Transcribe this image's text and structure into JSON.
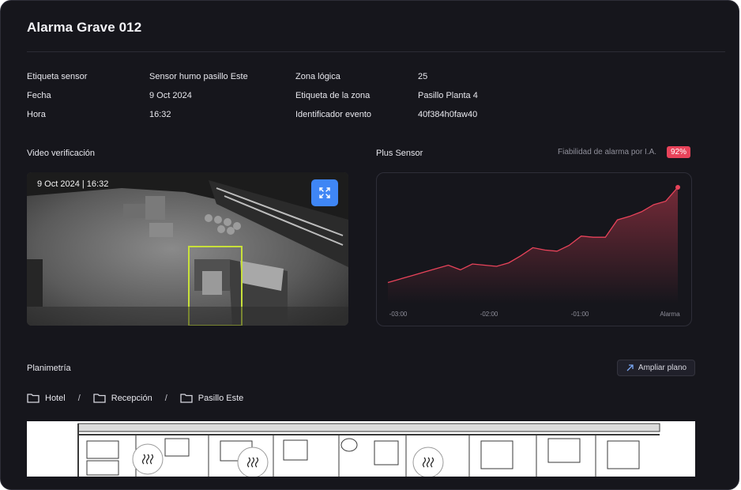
{
  "page": {
    "title": "Alarma Grave 012"
  },
  "info": {
    "left": [
      {
        "label": "Etiqueta sensor",
        "value": "Sensor humo pasillo Este"
      },
      {
        "label": "Fecha",
        "value": "9 Oct 2024"
      },
      {
        "label": "Hora",
        "value": "16:32"
      }
    ],
    "right": [
      {
        "label": "Zona lógica",
        "value": "25"
      },
      {
        "label": "Etiqueta de la zona",
        "value": "Pasillo Planta 4"
      },
      {
        "label": "Identificador evento",
        "value": "40f384h0faw40"
      }
    ]
  },
  "video": {
    "section_title": "Video verificación",
    "timestamp": "9 Oct 2024 | 16:32",
    "expand_icon": "expand-icon"
  },
  "sensor": {
    "section_title": "Plus Sensor",
    "reliability_label": "Fiabilidad de alarma por I.A.",
    "reliability_value": "92%"
  },
  "colors": {
    "accent": "#e8435a",
    "primary_button": "#3f86f5",
    "background": "#16161c",
    "detection_box": "#c8e03a"
  },
  "chart_data": {
    "type": "area",
    "x": [
      "-03:00",
      "-02:00",
      "-01:00",
      "Alarma"
    ],
    "series": [
      {
        "values": [
          0.18,
          0.21,
          0.24,
          0.27,
          0.3,
          0.33,
          0.29,
          0.34,
          0.33,
          0.32,
          0.35,
          0.41,
          0.48,
          0.46,
          0.45,
          0.5,
          0.58,
          0.57,
          0.57,
          0.72,
          0.75,
          0.79,
          0.85,
          0.88,
          1.0
        ]
      }
    ],
    "grid": false,
    "marker_last_point": true
  },
  "planimetria": {
    "section_title": "Planimetría",
    "expand_button_label": "Ampliar plano",
    "breadcrumb": [
      "Hotel",
      "Recepción",
      "Pasillo Este"
    ],
    "sensor_icon": "smoke-sensor-icon"
  }
}
